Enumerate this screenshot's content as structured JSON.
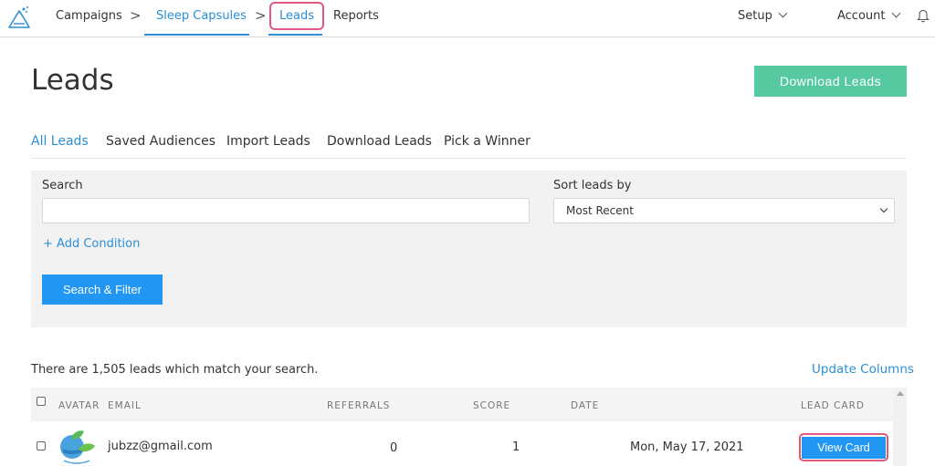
{
  "nav": {
    "campaigns": "Campaigns",
    "campaign_name": "Sleep Capsules",
    "leads": "Leads",
    "reports": "Reports",
    "setup": "Setup",
    "account": "Account",
    "separator": ">"
  },
  "header": {
    "title": "Leads",
    "download_button": "Download Leads"
  },
  "subtabs": {
    "all_leads": "All Leads",
    "saved_audiences": "Saved Audiences",
    "import_leads": "Import Leads",
    "download_leads": "Download Leads",
    "pick_winner": "Pick a Winner"
  },
  "filter": {
    "search_label": "Search",
    "search_value": "",
    "sort_label": "Sort leads by",
    "sort_value": "Most Recent",
    "add_condition": "+ Add Condition",
    "search_button": "Search & Filter"
  },
  "results": {
    "summary": "There are 1,505 leads which match your search.",
    "update_columns": "Update Columns"
  },
  "table": {
    "columns": {
      "avatar": "AVATAR",
      "email": "EMAIL",
      "referrals": "REFERRALS",
      "score": "SCORE",
      "date": "DATE",
      "lead_card": "LEAD CARD"
    },
    "rows": [
      {
        "email": "jubzz@gmail.com",
        "referrals": "0",
        "score": "1",
        "date": "Mon, May 17, 2021",
        "action": "View Card"
      }
    ]
  },
  "colors": {
    "accent": "#2b8fd6",
    "primary_button": "#2196f3",
    "success_button": "#56c9a0",
    "highlight": "#e05a7f",
    "panel_bg": "#f2f2f2"
  },
  "icons": {
    "logo": "flask-logo-icon",
    "bell": "bell-icon",
    "avatar": "leaf-globe-avatar"
  }
}
